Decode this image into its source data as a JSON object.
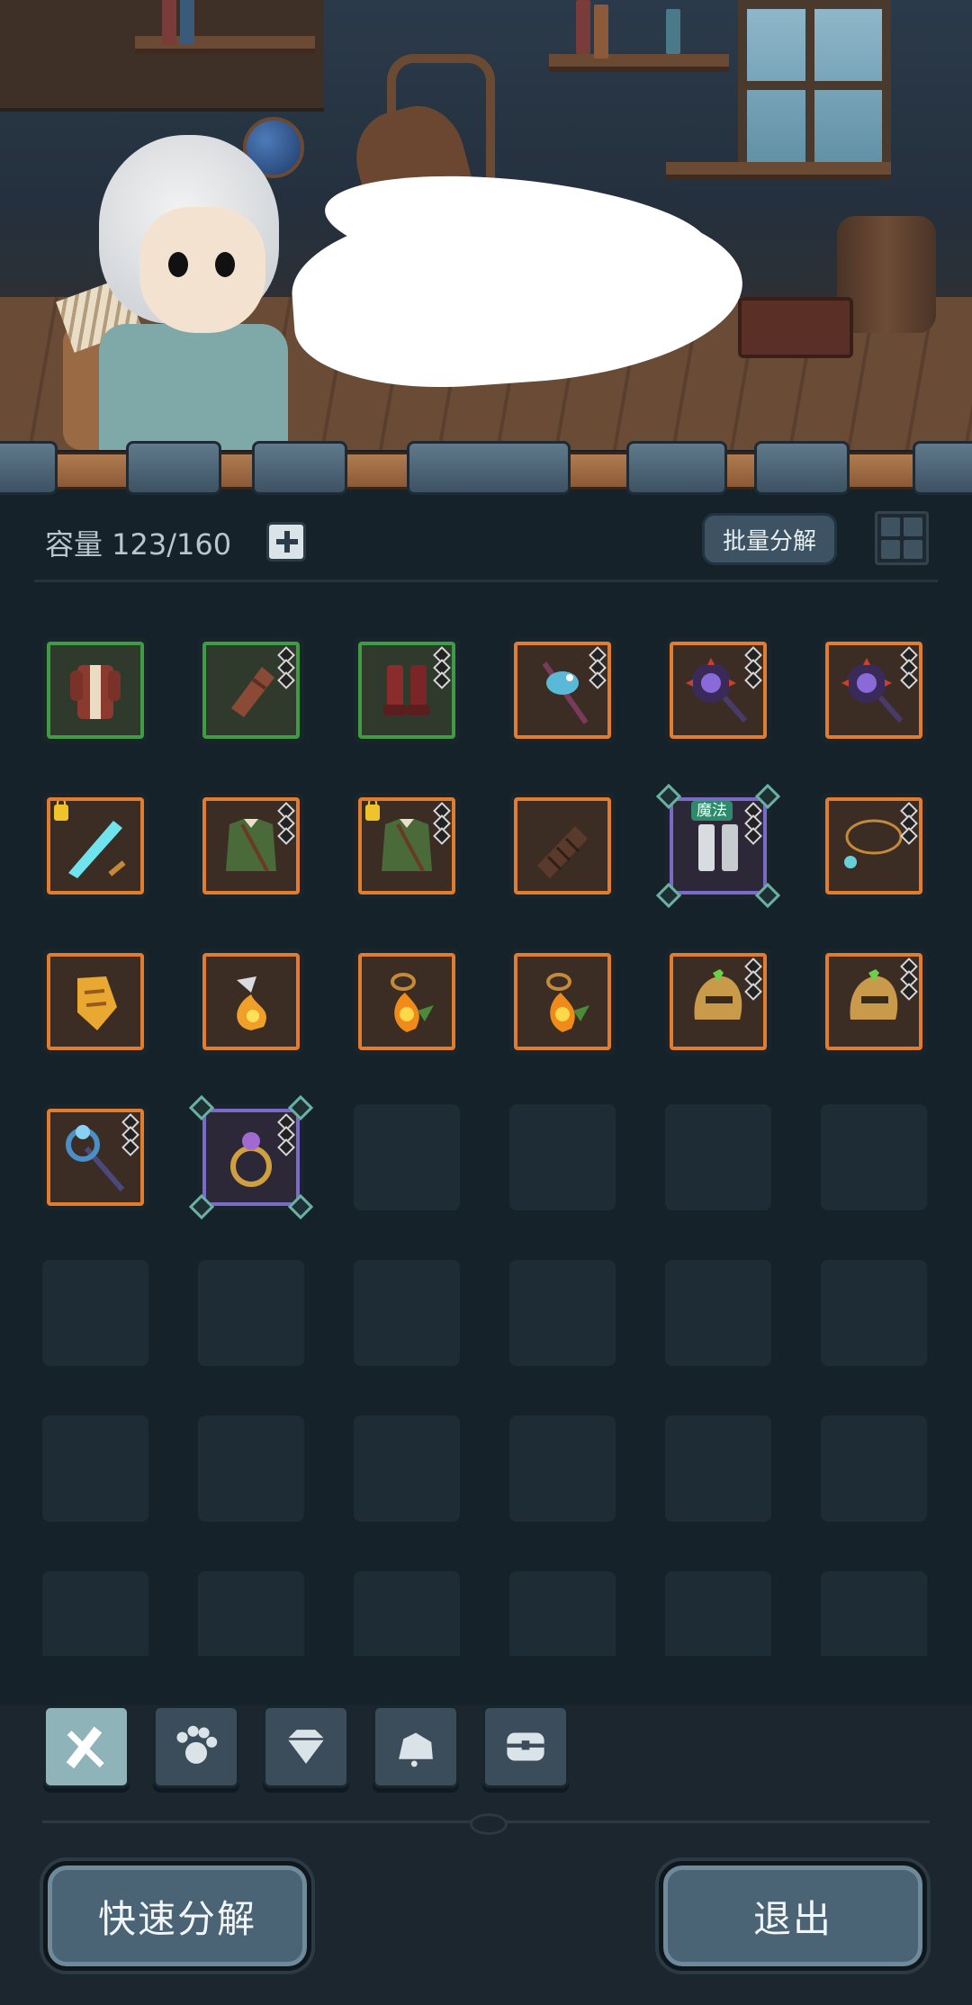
{
  "inventory": {
    "capacity_label": "容量 123/160",
    "bulk_decompose_label": "批量分解"
  },
  "items": [
    {
      "name": "robe-icon",
      "rarity": "green",
      "diamond": false,
      "lock": false
    },
    {
      "name": "bracer-icon",
      "rarity": "green",
      "diamond": true,
      "lock": false
    },
    {
      "name": "boots-icon",
      "rarity": "green",
      "diamond": true,
      "lock": false
    },
    {
      "name": "bird-staff-icon",
      "rarity": "orange",
      "diamond": true,
      "lock": false
    },
    {
      "name": "spiked-mace-icon",
      "rarity": "orange",
      "diamond": true,
      "lock": false
    },
    {
      "name": "spiked-mace-icon",
      "rarity": "orange",
      "diamond": true,
      "lock": false
    },
    {
      "name": "ice-sword-icon",
      "rarity": "orange",
      "diamond": false,
      "lock": true
    },
    {
      "name": "vest-icon",
      "rarity": "orange",
      "diamond": true,
      "lock": false
    },
    {
      "name": "vest-icon",
      "rarity": "orange",
      "diamond": true,
      "lock": true
    },
    {
      "name": "wrapped-bracer-icon",
      "rarity": "orange",
      "diamond": false,
      "lock": false
    },
    {
      "name": "greaves-icon",
      "rarity": "purple",
      "diamond": true,
      "lock": false,
      "tag": "魔法"
    },
    {
      "name": "necklace-icon",
      "rarity": "orange",
      "diamond": true,
      "lock": false
    },
    {
      "name": "gold-gauntlet-icon",
      "rarity": "orange",
      "diamond": false,
      "lock": false
    },
    {
      "name": "flame-gem-icon",
      "rarity": "orange",
      "diamond": false,
      "lock": false
    },
    {
      "name": "fire-pendant-icon",
      "rarity": "orange",
      "diamond": false,
      "lock": false
    },
    {
      "name": "fire-pendant-icon",
      "rarity": "orange",
      "diamond": false,
      "lock": false
    },
    {
      "name": "gold-helmet-icon",
      "rarity": "orange",
      "diamond": true,
      "lock": false
    },
    {
      "name": "gold-helmet-icon",
      "rarity": "orange",
      "diamond": true,
      "lock": false
    },
    {
      "name": "crystal-staff-icon",
      "rarity": "orange",
      "diamond": true,
      "lock": false
    },
    {
      "name": "ring-icon",
      "rarity": "purple",
      "diamond": true,
      "lock": false
    }
  ],
  "empty_slot_count": 22,
  "category_tabs": [
    {
      "name": "weapon-tab-icon",
      "active": true
    },
    {
      "name": "paw-tab-icon",
      "active": false
    },
    {
      "name": "gem-tab-icon",
      "active": false
    },
    {
      "name": "ore-tab-icon",
      "active": false
    },
    {
      "name": "chest-tab-icon",
      "active": false
    }
  ],
  "buttons": {
    "quick_decompose_label": "快速分解",
    "exit_label": "退出"
  },
  "colors": {
    "rarity_green": "#3f9b44",
    "rarity_orange": "#e27c2f",
    "rarity_purple": "#7b6bc8",
    "background": "#16222a"
  }
}
